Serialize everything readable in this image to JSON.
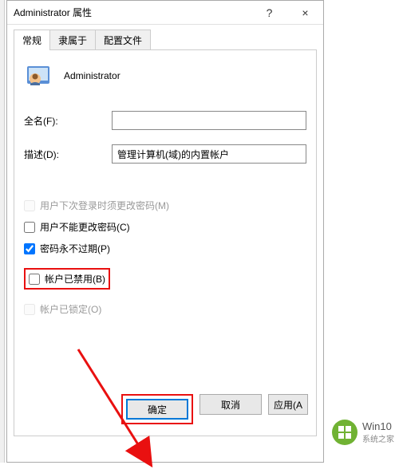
{
  "window": {
    "title": "Administrator 属性",
    "help_label": "?",
    "close_label": "×"
  },
  "tabs": {
    "general": "常规",
    "member_of": "隶属于",
    "profile": "配置文件"
  },
  "user": {
    "name": "Administrator"
  },
  "fields": {
    "fullname_label": "全名(F):",
    "fullname_value": "",
    "description_label": "描述(D):",
    "description_value": "管理计算机(域)的内置帐户"
  },
  "checkboxes": {
    "must_change": "用户下次登录时须更改密码(M)",
    "cannot_change": "用户不能更改密码(C)",
    "never_expires": "密码永不过期(P)",
    "disabled": "帐户已禁用(B)",
    "locked": "帐户已锁定(O)"
  },
  "buttons": {
    "ok": "确定",
    "cancel": "取消",
    "apply": "应用(A"
  },
  "watermark": {
    "title": "Win10",
    "subtitle": "系统之家"
  }
}
